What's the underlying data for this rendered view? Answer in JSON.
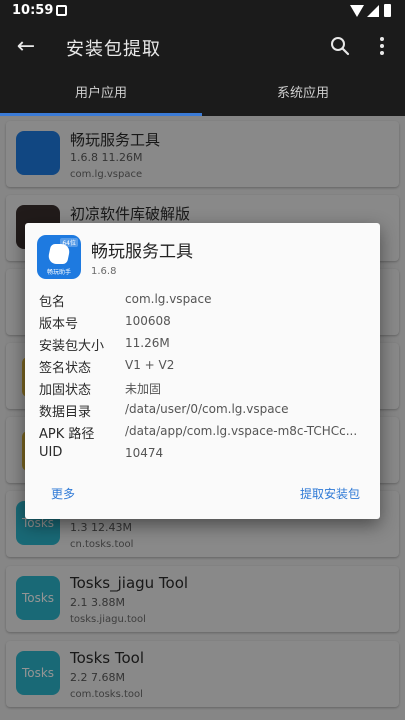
{
  "status_bar": {
    "time": "10:59"
  },
  "toolbar": {
    "title": "安装包提取",
    "back_icon": "arrow-left-icon",
    "search_icon": "search-icon",
    "more_icon": "more-vertical-icon"
  },
  "tabs": [
    {
      "label": "用户应用",
      "selected": true
    },
    {
      "label": "系统应用",
      "selected": false
    }
  ],
  "app_list": [
    {
      "name": "畅玩服务工具",
      "sub": "1.6.8   11.26M",
      "package": "com.lg.vspace"
    },
    {
      "name": "初凉软件库破解版",
      "sub": "",
      "package": ""
    },
    {
      "name": "",
      "sub": "1.3   12.43M",
      "package": "cn.tosks.tool",
      "icon_text": "Tosks"
    },
    {
      "name": "Tosks_jiagu Tool",
      "sub": "2.1   3.88M",
      "package": "tosks.jiagu.tool",
      "icon_text": "Tosks"
    },
    {
      "name": "Tosks Tool",
      "sub": "2.2   7.68M",
      "package": "com.tosks.tool",
      "icon_text": "Tosks"
    }
  ],
  "dialog": {
    "app_name": "畅玩服务工具",
    "version": "1.6.8",
    "icon_badge": "64位",
    "icon_caption": "畅玩助手",
    "rows": [
      {
        "label": "包名",
        "value": "com.lg.vspace"
      },
      {
        "label": "版本号",
        "value": "100608"
      },
      {
        "label": "安装包大小",
        "value": "11.26M"
      },
      {
        "label": "签名状态",
        "value": "V1 + V2"
      },
      {
        "label": "加固状态",
        "value": "未加固"
      },
      {
        "label": "数据目录",
        "value": "/data/user/0/com.lg.vspace"
      },
      {
        "label": "APK 路径",
        "value": "/data/app/com.lg.vspace-m8c-TCHCc..."
      },
      {
        "label": "UID",
        "value": "10474"
      }
    ],
    "more_button": "更多",
    "extract_button": "提取安装包"
  },
  "colors": {
    "accent": "#2f7ad6",
    "toolbar_bg": "#1b1b1b",
    "tab_indicator": "#3b7bd6",
    "app_icon_blue": "#1e7ae0",
    "tosks_icon": "#2cb6cb"
  }
}
